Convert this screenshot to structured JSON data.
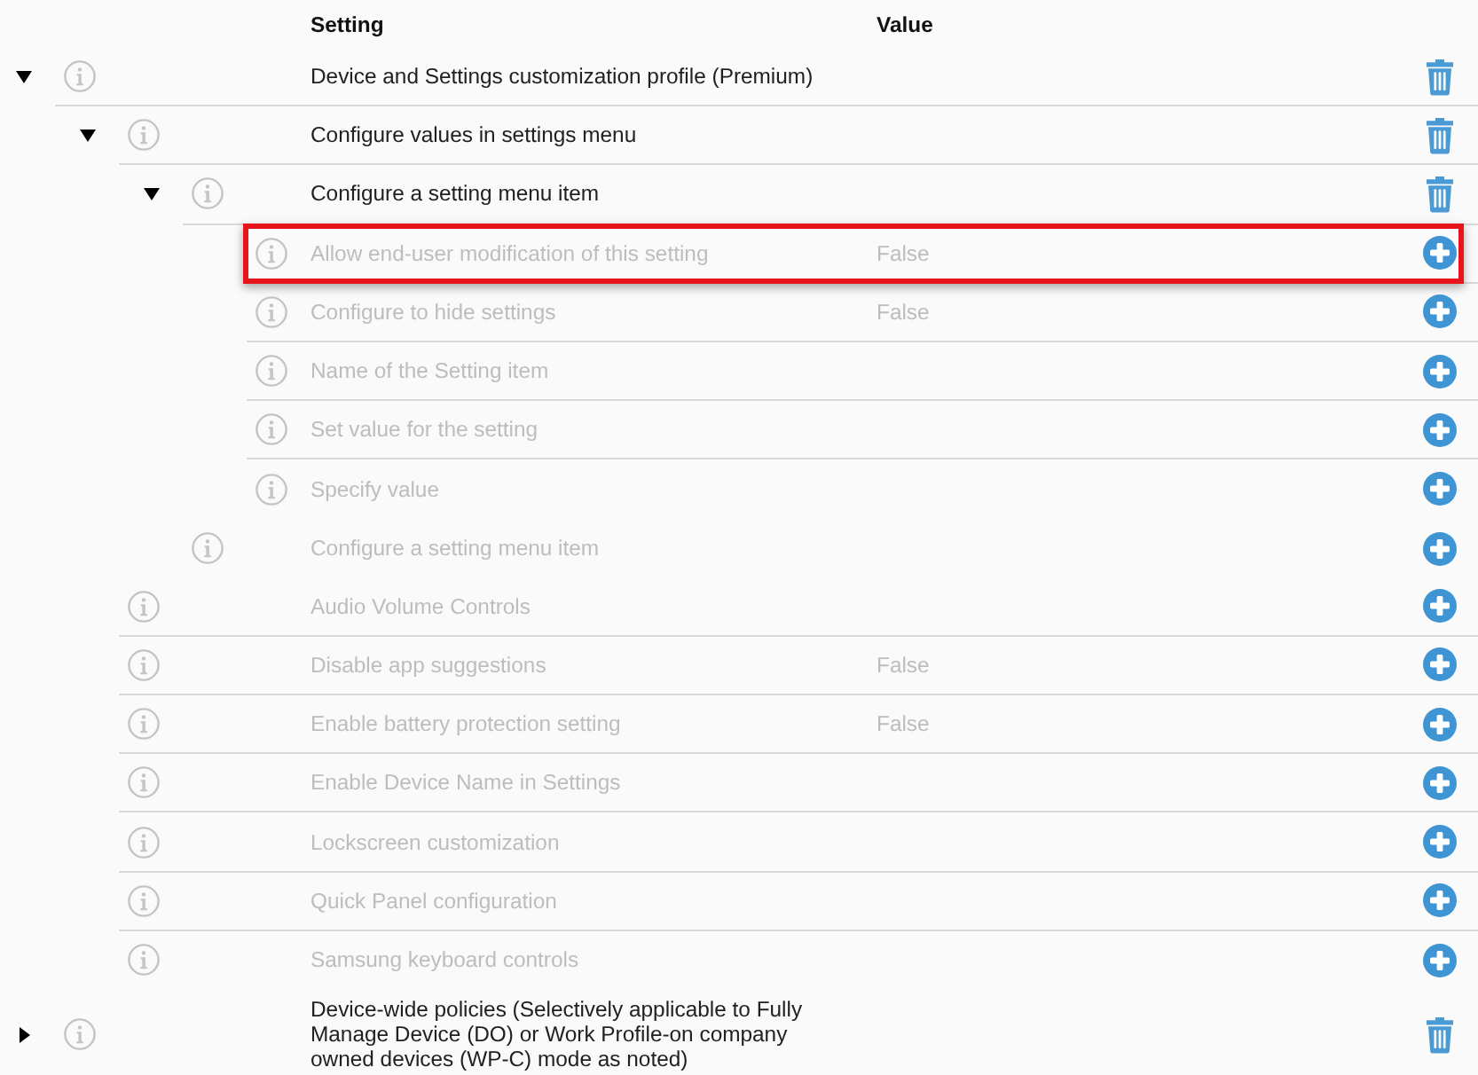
{
  "table": {
    "columns": [
      {
        "label": "Setting"
      },
      {
        "label": "Value"
      }
    ],
    "rows": [
      {
        "setting": "Device and Settings customization profile (Premium)",
        "disabled": false,
        "kind": "delete",
        "highlighted": false,
        "expanded": true,
        "children": [
          {
            "setting": "Configure values in settings menu",
            "disabled": false,
            "kind": "delete",
            "highlighted": false,
            "expanded": true,
            "children": [
              {
                "setting": "Configure a setting menu item",
                "disabled": false,
                "kind": "delete",
                "highlighted": false,
                "expanded": true,
                "children": [
                  {
                    "setting": "Allow end-user modification of this setting",
                    "value": "False",
                    "disabled": true,
                    "kind": "add",
                    "highlighted": true
                  },
                  {
                    "setting": "Configure to hide settings",
                    "value": "False",
                    "disabled": true,
                    "kind": "add",
                    "highlighted": false
                  },
                  {
                    "setting": "Name of the Setting item",
                    "disabled": true,
                    "kind": "add",
                    "highlighted": false
                  },
                  {
                    "setting": "Set value for the setting",
                    "disabled": true,
                    "kind": "add",
                    "highlighted": false
                  },
                  {
                    "setting": "Specify value",
                    "disabled": true,
                    "kind": "add",
                    "highlighted": false
                  }
                ]
              },
              {
                "setting": "Configure a setting menu item",
                "disabled": true,
                "kind": "add",
                "highlighted": false
              }
            ]
          },
          {
            "setting": "Audio Volume Controls",
            "disabled": true,
            "kind": "add",
            "highlighted": false
          },
          {
            "setting": "Disable app suggestions",
            "value": "False",
            "disabled": true,
            "kind": "add",
            "highlighted": false
          },
          {
            "setting": "Enable battery protection setting",
            "value": "False",
            "disabled": true,
            "kind": "add",
            "highlighted": false
          },
          {
            "setting": "Enable Device Name in Settings",
            "disabled": true,
            "kind": "add",
            "highlighted": false
          },
          {
            "setting": "Lockscreen customization",
            "disabled": true,
            "kind": "add",
            "highlighted": false
          },
          {
            "setting": "Quick Panel configuration",
            "disabled": true,
            "kind": "add",
            "highlighted": false
          },
          {
            "setting": "Samsung keyboard controls",
            "disabled": true,
            "kind": "add",
            "highlighted": false
          }
        ]
      },
      {
        "setting": "Device-wide policies (Selectively applicable to Fully Manage Device (DO) or Work Profile-on company owned devices (WP-C) mode as noted)",
        "disabled": false,
        "kind": "delete",
        "highlighted": false,
        "expanded": false
      }
    ]
  }
}
